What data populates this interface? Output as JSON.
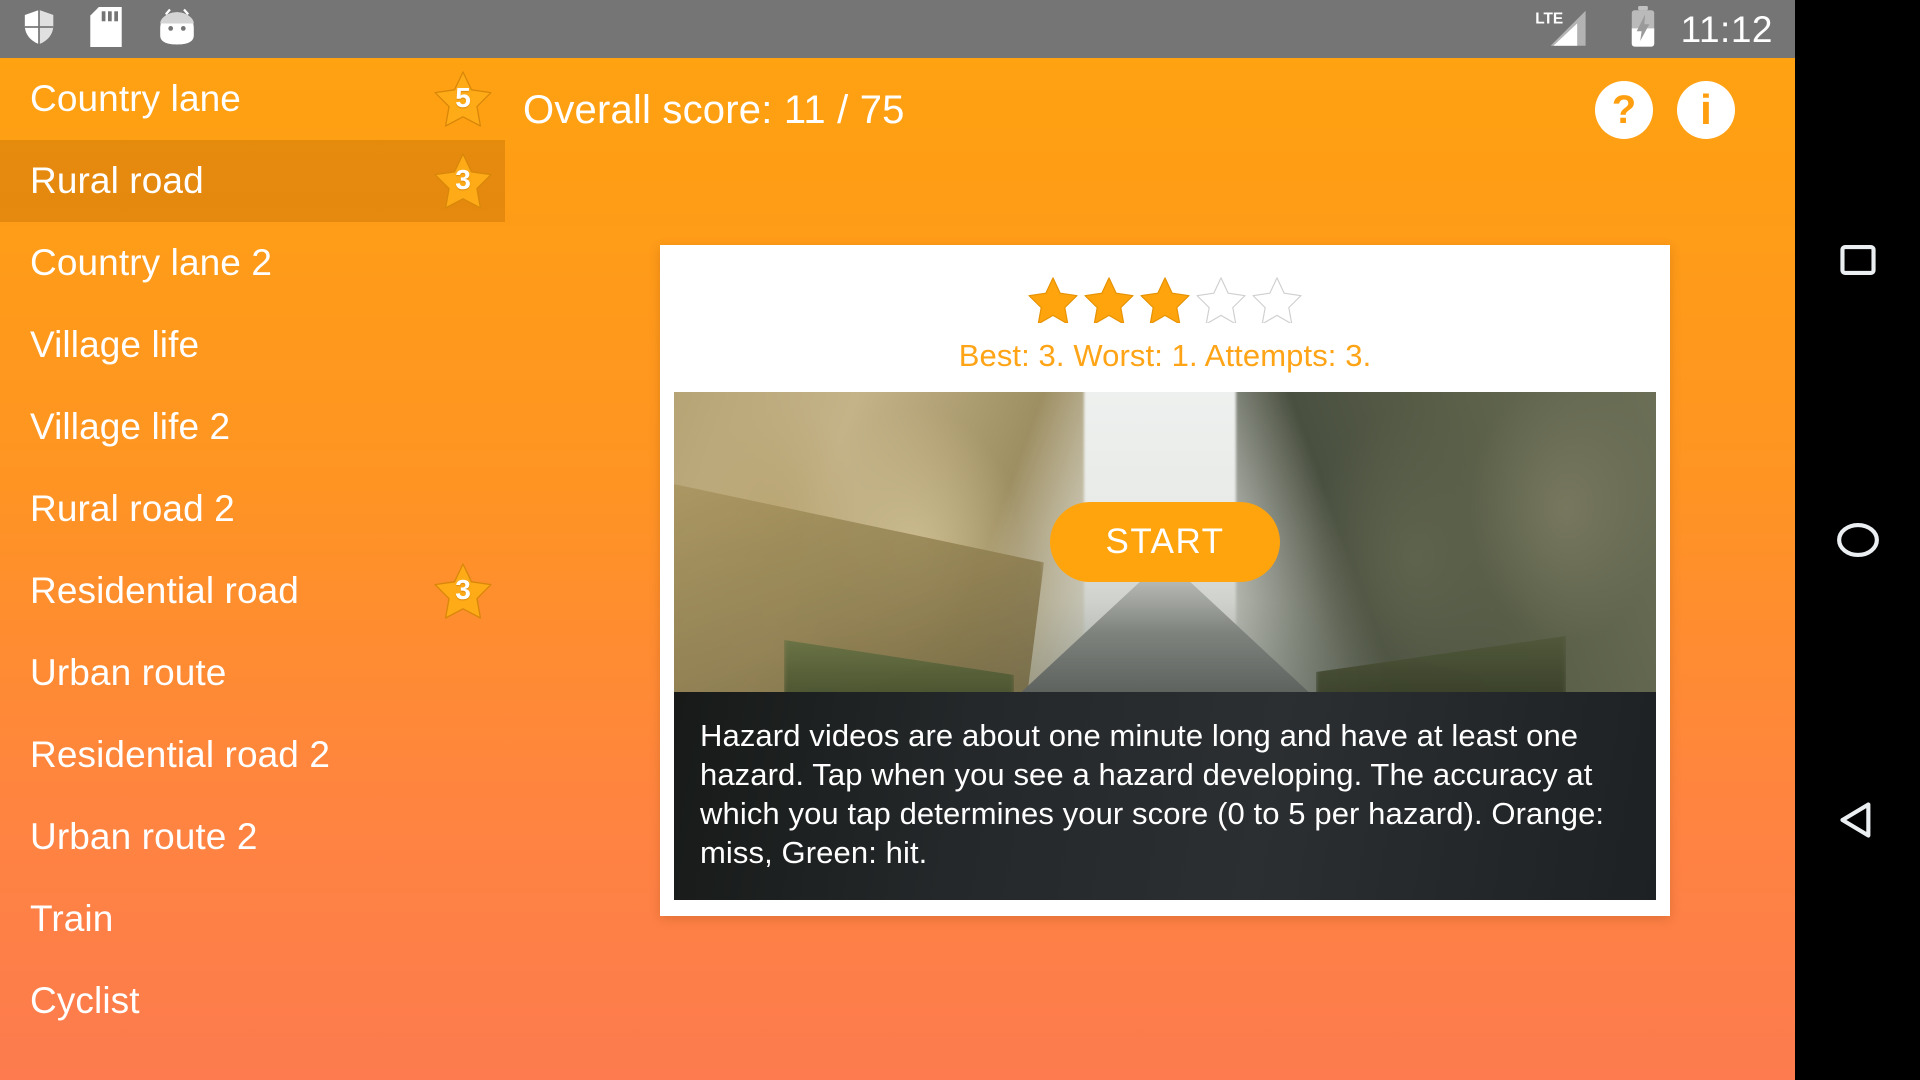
{
  "status_bar": {
    "icons": [
      "shield-icon",
      "sd-card-icon",
      "android-head-icon"
    ],
    "network_label": "LTE",
    "signal_icon": "signal-bars-icon",
    "battery_icon": "battery-charging-icon",
    "clock": "11:12",
    "background_color": "#757575"
  },
  "topbar": {
    "overall_score": "Overall score: 11 / 75",
    "help_label": "?",
    "info_label": "i",
    "accent_color": "#FF9E0F"
  },
  "sidebar": {
    "items": [
      {
        "label": "Country lane",
        "score": "5",
        "has_badge": true,
        "selected": false
      },
      {
        "label": "Rural road",
        "score": "3",
        "has_badge": true,
        "selected": true
      },
      {
        "label": "Country lane 2",
        "score": "",
        "has_badge": false,
        "selected": false
      },
      {
        "label": "Village life",
        "score": "",
        "has_badge": false,
        "selected": false
      },
      {
        "label": "Village life 2",
        "score": "",
        "has_badge": false,
        "selected": false
      },
      {
        "label": "Rural road 2",
        "score": "",
        "has_badge": false,
        "selected": false
      },
      {
        "label": "Residential road",
        "score": "3",
        "has_badge": true,
        "selected": false
      },
      {
        "label": "Urban route",
        "score": "",
        "has_badge": false,
        "selected": false
      },
      {
        "label": "Residential road 2",
        "score": "",
        "has_badge": false,
        "selected": false
      },
      {
        "label": "Urban route 2",
        "score": "",
        "has_badge": false,
        "selected": false
      },
      {
        "label": "Train",
        "score": "",
        "has_badge": false,
        "selected": false
      },
      {
        "label": "Cyclist",
        "score": "",
        "has_badge": false,
        "selected": false
      }
    ]
  },
  "card": {
    "rating_filled": 3,
    "rating_total": 5,
    "attempts_line": "Best: 3. Worst: 1. Attempts: 3.",
    "attempts_color": "#FFA416",
    "start_label": "START",
    "start_color": "#FFA40C",
    "description": "Hazard videos are about one minute long and have at least one hazard. Tap when you see a hazard developing. The accuracy at which you tap determines your score (0 to 5 per hazard). Orange: miss, Green: hit.",
    "thumbnail_alt": "country-road-video-thumbnail"
  },
  "navbar": {
    "recents": "recents-square-icon",
    "home": "home-circle-icon",
    "back": "back-triangle-icon"
  }
}
